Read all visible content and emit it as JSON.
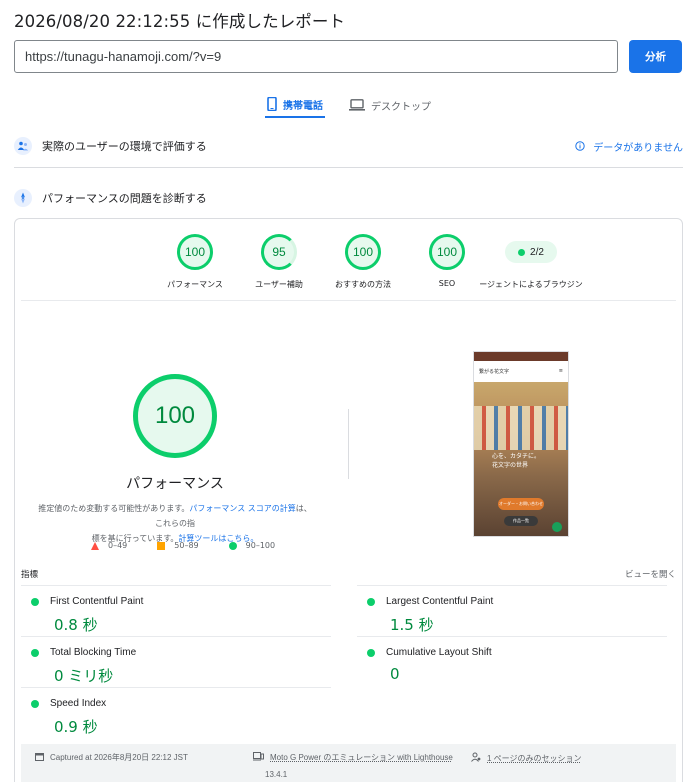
{
  "report_title": "2026/08/20 22:12:55 に作成したレポート",
  "url_input": {
    "value": "https://tunagu-hanamoji.com/?v=9"
  },
  "analyze_button": "分析",
  "device_tabs": [
    {
      "label": "携帯電話",
      "icon": "smartphone-icon",
      "active": true
    },
    {
      "label": "デスクトップ",
      "icon": "laptop-icon",
      "active": false
    }
  ],
  "field_section": {
    "title": "実際のユーザーの環境で評価する",
    "status": "データがありません"
  },
  "lab_section": {
    "title": "パフォーマンスの問題を診断する"
  },
  "scores": [
    {
      "value": "100",
      "label": "パフォーマンス"
    },
    {
      "value": "95",
      "label": "ユーザー補助"
    },
    {
      "value": "100",
      "label": "おすすめの方法"
    },
    {
      "value": "100",
      "label": "SEO"
    }
  ],
  "pwa": {
    "value": "2/2",
    "label": "ージェントによるブラウジン"
  },
  "performance": {
    "score": "100",
    "label": "パフォーマンス",
    "desc_1": "推定値のため変動する可能性があります。",
    "link_1": "パフォーマンス スコアの計算",
    "desc_2": "は、これらの指",
    "desc_3": "標を基に行っています。",
    "link_2": "計算ツールはこちら。"
  },
  "legend": [
    {
      "shape": "triangle",
      "range": "0–49",
      "color": "#ff4e42"
    },
    {
      "shape": "square",
      "range": "50–89",
      "color": "#ffa400"
    },
    {
      "shape": "circle",
      "range": "90–100",
      "color": "#0cce6b"
    }
  ],
  "screenshot": {
    "site_name": "繋がる花文字",
    "hero_line_1": "心を、カタチに。",
    "hero_line_2": "花文字の世界",
    "cta": "オーダー・お問い合わせ",
    "cta_2": "作品一覧",
    "menu_icon": "hamburger-icon"
  },
  "metrics_header": {
    "label": "指標",
    "expand": "ビューを開く"
  },
  "metrics": [
    {
      "name": "First Contentful Paint",
      "value": "0.8 秒"
    },
    {
      "name": "Largest Contentful Paint",
      "value": "1.5 秒"
    },
    {
      "name": "Total Blocking Time",
      "value": "0 ミリ秒"
    },
    {
      "name": "Cumulative Layout Shift",
      "value": "0"
    },
    {
      "name": "Speed Index",
      "value": "0.9 秒"
    }
  ],
  "footer": {
    "captured": "Captured at 2026年8月20日 22:12 JST",
    "device": "Moto G Power のエミュレーション with Lighthouse",
    "version": "13.4.1",
    "session": "1 ページのみのセッション"
  },
  "colors": {
    "accent": "#1a73e8",
    "pass": "#0cce6b",
    "pass_text": "#008a3e"
  }
}
